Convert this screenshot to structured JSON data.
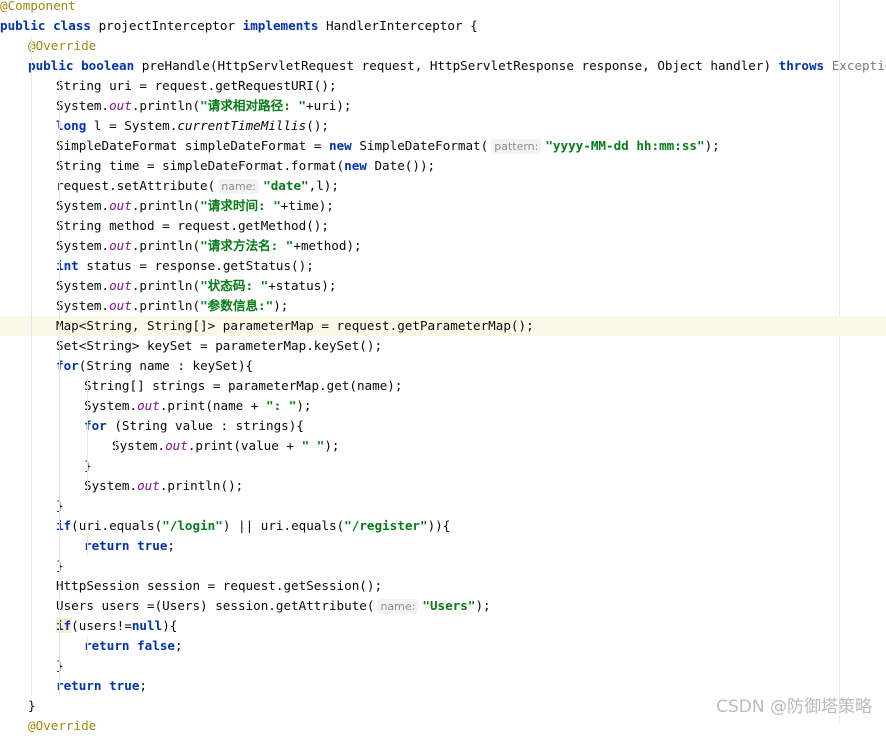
{
  "editor": {
    "language": "java",
    "current_line": 16,
    "lines": [
      {
        "indent": 0,
        "tokens": [
          [
            "ann",
            "@Component"
          ]
        ]
      },
      {
        "indent": 0,
        "tokens": [
          [
            "kw",
            "public class "
          ],
          [
            "",
            "projectInterceptor "
          ],
          [
            "kw",
            "implements "
          ],
          [
            "",
            "HandlerInterceptor {"
          ]
        ]
      },
      {
        "indent": 1,
        "tokens": [
          [
            "ann",
            "@Override"
          ]
        ]
      },
      {
        "indent": 1,
        "tokens": [
          [
            "kw",
            "public boolean "
          ],
          [
            "",
            "preHandle(HttpServletRequest request, HttpServletResponse response, Object handler) "
          ],
          [
            "kw",
            "throws "
          ],
          [
            "exc",
            "Exception"
          ],
          [
            "",
            " {"
          ]
        ]
      },
      {
        "indent": 2,
        "tokens": [
          [
            "",
            "String uri = request.getRequestURI();"
          ]
        ]
      },
      {
        "indent": 2,
        "tokens": [
          [
            "",
            "System."
          ],
          [
            "fld",
            "out"
          ],
          [
            "",
            ".println("
          ],
          [
            "str",
            "\"请求相对路径: \""
          ],
          [
            "",
            "+uri);"
          ]
        ]
      },
      {
        "indent": 2,
        "tokens": [
          [
            "kw",
            "long "
          ],
          [
            "",
            "l = System."
          ],
          [
            "smc",
            "currentTimeMillis"
          ],
          [
            "",
            "();"
          ]
        ]
      },
      {
        "indent": 2,
        "tokens": [
          [
            "",
            "SimpleDateFormat simpleDateFormat = "
          ],
          [
            "kw",
            "new "
          ],
          [
            "",
            "SimpleDateFormat("
          ],
          [
            "hint",
            "pattern:"
          ],
          [
            "str",
            "\"yyyy-MM-dd hh:mm:ss\""
          ],
          [
            "",
            ");"
          ]
        ]
      },
      {
        "indent": 2,
        "tokens": [
          [
            "",
            "String time = simpleDateFormat.format("
          ],
          [
            "kw",
            "new "
          ],
          [
            "",
            "Date());"
          ]
        ]
      },
      {
        "indent": 2,
        "tokens": [
          [
            "",
            "request.setAttribute("
          ],
          [
            "hint",
            "name:"
          ],
          [
            "str",
            "\"date\""
          ],
          [
            "",
            ",l);"
          ]
        ]
      },
      {
        "indent": 2,
        "tokens": [
          [
            "",
            "System."
          ],
          [
            "fld",
            "out"
          ],
          [
            "",
            ".println("
          ],
          [
            "str",
            "\"请求时间: \""
          ],
          [
            "",
            "+time);"
          ]
        ]
      },
      {
        "indent": 2,
        "tokens": [
          [
            "",
            "String method = request.getMethod();"
          ]
        ]
      },
      {
        "indent": 2,
        "tokens": [
          [
            "",
            "System."
          ],
          [
            "fld",
            "out"
          ],
          [
            "",
            ".println("
          ],
          [
            "str",
            "\"请求方法名: \""
          ],
          [
            "",
            "+method);"
          ]
        ]
      },
      {
        "indent": 2,
        "tokens": [
          [
            "kw",
            "int "
          ],
          [
            "",
            "status = response.getStatus();"
          ]
        ]
      },
      {
        "indent": 2,
        "tokens": [
          [
            "",
            "System."
          ],
          [
            "fld",
            "out"
          ],
          [
            "",
            ".println("
          ],
          [
            "str",
            "\"状态码: \""
          ],
          [
            "",
            "+status);"
          ]
        ]
      },
      {
        "indent": 2,
        "tokens": [
          [
            "",
            "System."
          ],
          [
            "fld",
            "out"
          ],
          [
            "",
            ".println("
          ],
          [
            "str",
            "\"参数信息:\""
          ],
          [
            "",
            ");"
          ]
        ]
      },
      {
        "indent": 2,
        "tokens": [
          [
            "",
            "Map<String, String[]> parameterMap = request.getParameterMap();"
          ]
        ]
      },
      {
        "indent": 2,
        "tokens": [
          [
            "",
            "Set<String> keySet = parameterMap.keySet();"
          ]
        ]
      },
      {
        "indent": 2,
        "tokens": [
          [
            "kw",
            "for"
          ],
          [
            "",
            "(String name : keySet){"
          ]
        ]
      },
      {
        "indent": 3,
        "tokens": [
          [
            "",
            "String[] strings = parameterMap.get(name);"
          ]
        ]
      },
      {
        "indent": 3,
        "tokens": [
          [
            "",
            "System."
          ],
          [
            "fld",
            "out"
          ],
          [
            "",
            ".print(name + "
          ],
          [
            "str",
            "\": \""
          ],
          [
            "",
            ");"
          ]
        ]
      },
      {
        "indent": 3,
        "tokens": [
          [
            "kw",
            "for "
          ],
          [
            "",
            "(String value : strings){"
          ]
        ]
      },
      {
        "indent": 4,
        "tokens": [
          [
            "",
            "System."
          ],
          [
            "fld",
            "out"
          ],
          [
            "",
            ".print(value + "
          ],
          [
            "str",
            "\" \""
          ],
          [
            "",
            ");"
          ]
        ]
      },
      {
        "indent": 3,
        "tokens": [
          [
            "",
            "}"
          ]
        ]
      },
      {
        "indent": 3,
        "tokens": [
          [
            "",
            "System."
          ],
          [
            "fld",
            "out"
          ],
          [
            "",
            ".println();"
          ]
        ]
      },
      {
        "indent": 2,
        "tokens": [
          [
            "",
            "}"
          ]
        ]
      },
      {
        "indent": 2,
        "tokens": [
          [
            "kw",
            "if"
          ],
          [
            "",
            "(uri.equals("
          ],
          [
            "str",
            "\"/login\""
          ],
          [
            "",
            ") || uri.equals("
          ],
          [
            "str",
            "\"/register\""
          ],
          [
            "",
            ")){"
          ]
        ]
      },
      {
        "indent": 3,
        "tokens": [
          [
            "kw",
            "return true"
          ],
          [
            "",
            ";"
          ]
        ]
      },
      {
        "indent": 2,
        "tokens": [
          [
            "",
            "}"
          ]
        ]
      },
      {
        "indent": 2,
        "tokens": [
          [
            "",
            "HttpSession session = request.getSession();"
          ]
        ]
      },
      {
        "indent": 2,
        "tokens": [
          [
            "",
            "Users users =(Users) session.getAttribute("
          ],
          [
            "hint",
            "name:"
          ],
          [
            "str",
            "\"Users\""
          ],
          [
            "",
            ");"
          ]
        ]
      },
      {
        "indent": 2,
        "tokens": [
          [
            "kwhl",
            "if"
          ],
          [
            "",
            "(users!="
          ],
          [
            "kw",
            "null"
          ],
          [
            "",
            "){"
          ]
        ]
      },
      {
        "indent": 3,
        "tokens": [
          [
            "kw",
            "return false"
          ],
          [
            "",
            ";"
          ]
        ]
      },
      {
        "indent": 2,
        "tokens": [
          [
            "",
            "}"
          ]
        ]
      },
      {
        "indent": 2,
        "tokens": [
          [
            "kw",
            "return true"
          ],
          [
            "",
            ";"
          ]
        ]
      },
      {
        "indent": 1,
        "tokens": [
          [
            "",
            "}"
          ]
        ]
      },
      {
        "indent": 1,
        "tokens": [
          [
            "ann",
            "@Override"
          ]
        ]
      }
    ]
  },
  "watermark": "CSDN @防御塔策略"
}
